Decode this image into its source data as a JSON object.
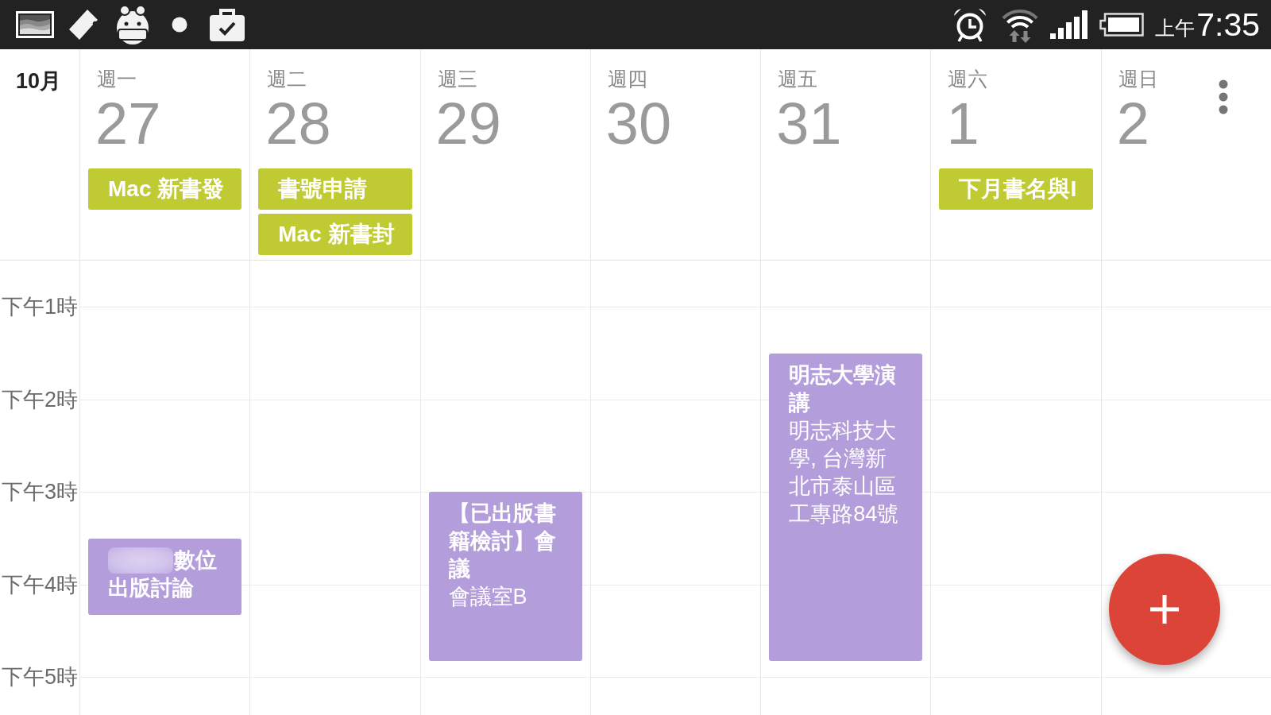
{
  "status_bar": {
    "period": "上午",
    "time": "7:35"
  },
  "header": {
    "month": "10月"
  },
  "days": [
    {
      "weekday": "週一",
      "date": "27",
      "all_day_events": [
        {
          "title": "Mac 新書發",
          "color": "#c0ca33"
        }
      ],
      "events": [
        {
          "title": "數位出版討論",
          "redacted": true,
          "color": "#b39ddb"
        }
      ]
    },
    {
      "weekday": "週二",
      "date": "28",
      "all_day_events": [
        {
          "title": "書號申請",
          "color": "#c0ca33"
        },
        {
          "title": "Mac 新書封",
          "color": "#c0ca33"
        }
      ]
    },
    {
      "weekday": "週三",
      "date": "29",
      "events": [
        {
          "title": "【已出版書籍檢討】會議",
          "location": "會議室B",
          "redacted": false,
          "color": "#b39ddb"
        }
      ]
    },
    {
      "weekday": "週四",
      "date": "30"
    },
    {
      "weekday": "週五",
      "date": "31",
      "events": [
        {
          "title": "明志大學演講",
          "location": "明志科技大學, 台灣新北市泰山區工專路84號",
          "redacted": false,
          "color": "#b39ddb"
        }
      ]
    },
    {
      "weekday": "週六",
      "date": "1",
      "all_day_events": [
        {
          "title": "下月書名與I",
          "color": "#c0ca33"
        }
      ]
    },
    {
      "weekday": "週日",
      "date": "2"
    }
  ],
  "time_labels": [
    "下午1時",
    "下午2時",
    "下午3時",
    "下午4時",
    "下午5時"
  ]
}
